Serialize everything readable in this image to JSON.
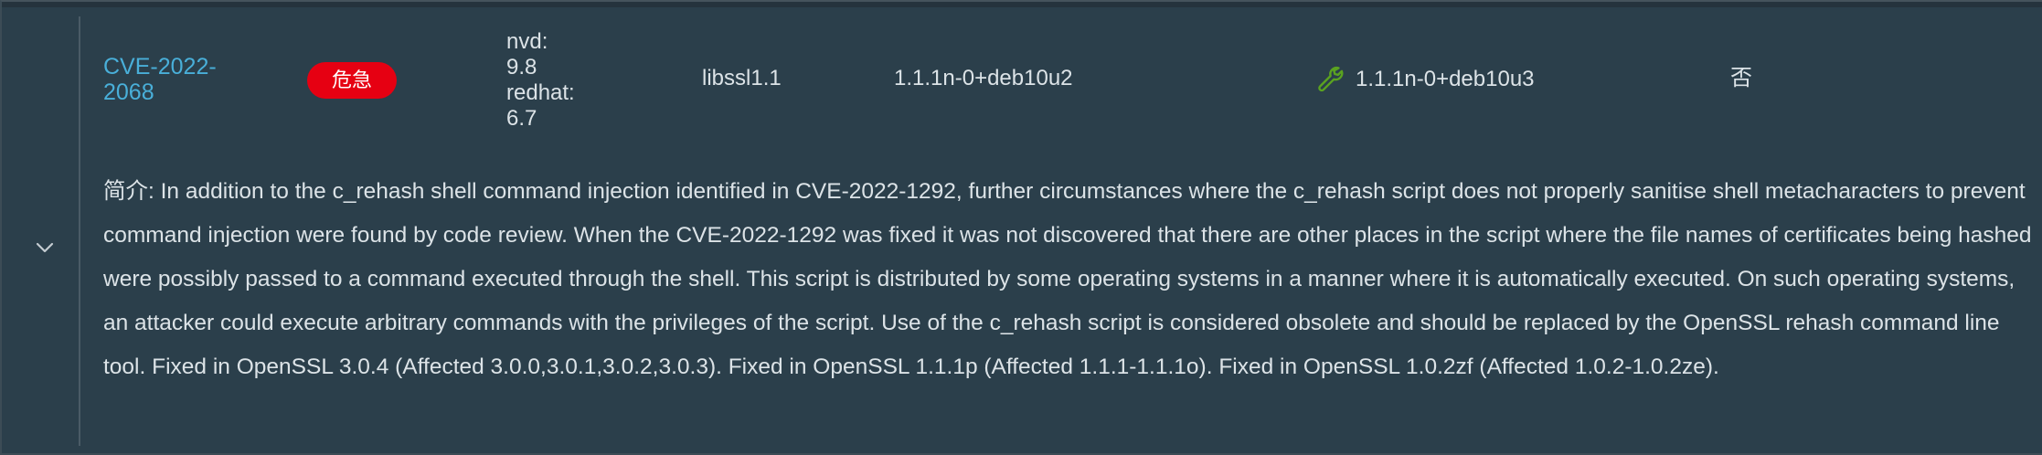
{
  "row": {
    "cve_id": "CVE-2022-2068",
    "severity": "危急",
    "scores": [
      "nvd:",
      "9.8",
      "redhat:",
      "6.7"
    ],
    "package": "libssl1.1",
    "installed_version": "1.1.1n-0+deb10u2",
    "fixed_version": "1.1.1n-0+deb10u3",
    "flag": "否",
    "expander_icon": "chevron-down-icon",
    "fix_icon": "wrench-icon"
  },
  "detail": {
    "description": "简介: In addition to the c_rehash shell command injection identified in CVE-2022-1292, further circumstances where the c_rehash script does not properly sanitise shell metacharacters to prevent command injection were found by code review. When the CVE-2022-1292 was fixed it was not discovered that there are other places in the script where the file names of certificates being hashed were possibly passed to a command executed through the shell. This script is distributed by some operating systems in a manner where it is automatically executed. On such operating systems, an attacker could execute arbitrary commands with the privileges of the script. Use of the c_rehash script is considered obsolete and should be replaced by the OpenSSL rehash command line tool. Fixed in OpenSSL 3.0.4 (Affected 3.0.0,3.0.1,3.0.2,3.0.3). Fixed in OpenSSL 1.1.1p (Affected 1.1.1-1.1.1o). Fixed in OpenSSL 1.0.2zf (Affected 1.0.2-1.0.2ze)."
  },
  "colors": {
    "background": "#2b3f4b",
    "link": "#49afd9",
    "badge_critical": "#e60012",
    "text": "#dce3e7",
    "wrench": "#5aa220"
  }
}
